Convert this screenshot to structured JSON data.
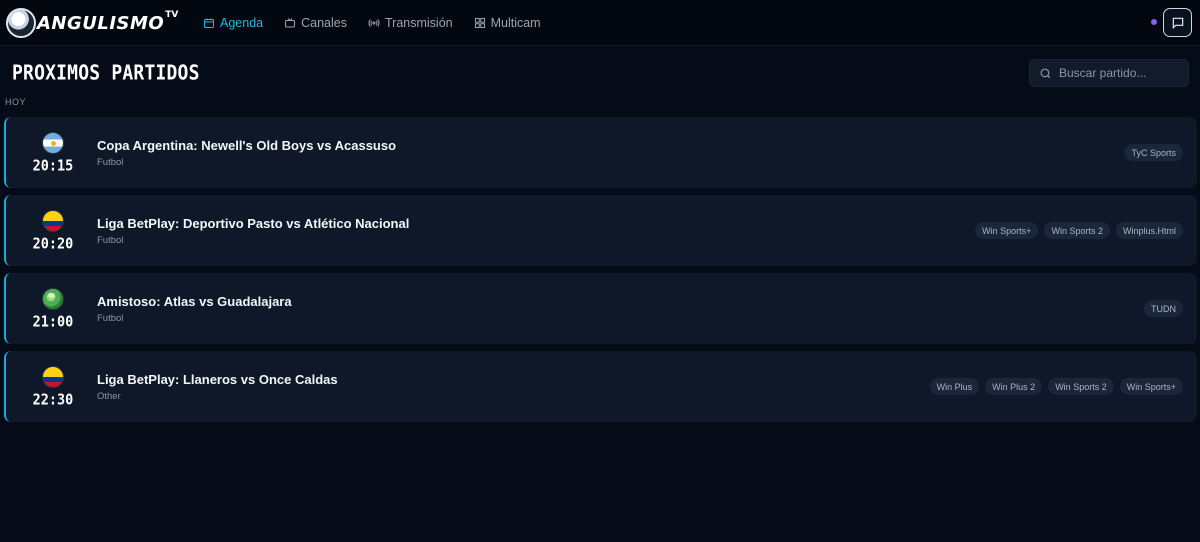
{
  "app": {
    "logo_text": "ANGULISMO",
    "logo_suffix": "TV"
  },
  "nav": {
    "items": [
      {
        "label": "Agenda",
        "icon": "calendar-icon",
        "active": true
      },
      {
        "label": "Canales",
        "icon": "tv-icon",
        "active": false
      },
      {
        "label": "Transmisión",
        "icon": "broadcast-icon",
        "active": false
      },
      {
        "label": "Multicam",
        "icon": "grid-icon",
        "active": false
      }
    ]
  },
  "header": {
    "chat_icon": "chat-icon",
    "status_color": "#8b5cf6"
  },
  "main": {
    "title": "PROXIMOS PARTIDOS",
    "search_placeholder": "Buscar partido...",
    "section_label": "HOY"
  },
  "matches": [
    {
      "flag": "argentina-flag-icon",
      "time": "20:15",
      "title": "Copa Argentina: Newell's Old Boys vs Acassuso",
      "sport": "Futbol",
      "channels": [
        "TyC Sports"
      ]
    },
    {
      "flag": "colombia-flag-icon",
      "time": "20:20",
      "title": "Liga BetPlay: Deportivo Pasto vs Atlético Nacional",
      "sport": "Futbol",
      "channels": [
        "Win Sports+",
        "Win Sports 2",
        "Winplus.Html"
      ]
    },
    {
      "flag": "world-globe-icon",
      "time": "21:00",
      "title": "Amistoso: Atlas vs Guadalajara",
      "sport": "Futbol",
      "channels": [
        "TUDN"
      ]
    },
    {
      "flag": "colombia-flag-icon",
      "time": "22:30",
      "title": "Liga BetPlay: Llaneros vs Once Caldas",
      "sport": "Other",
      "channels": [
        "Win Plus",
        "Win Plus 2",
        "Win Sports 2",
        "Win Sports+"
      ]
    }
  ],
  "colors": {
    "accent": "#22b8e8",
    "background": "#050b17",
    "card": "#0e1828"
  }
}
